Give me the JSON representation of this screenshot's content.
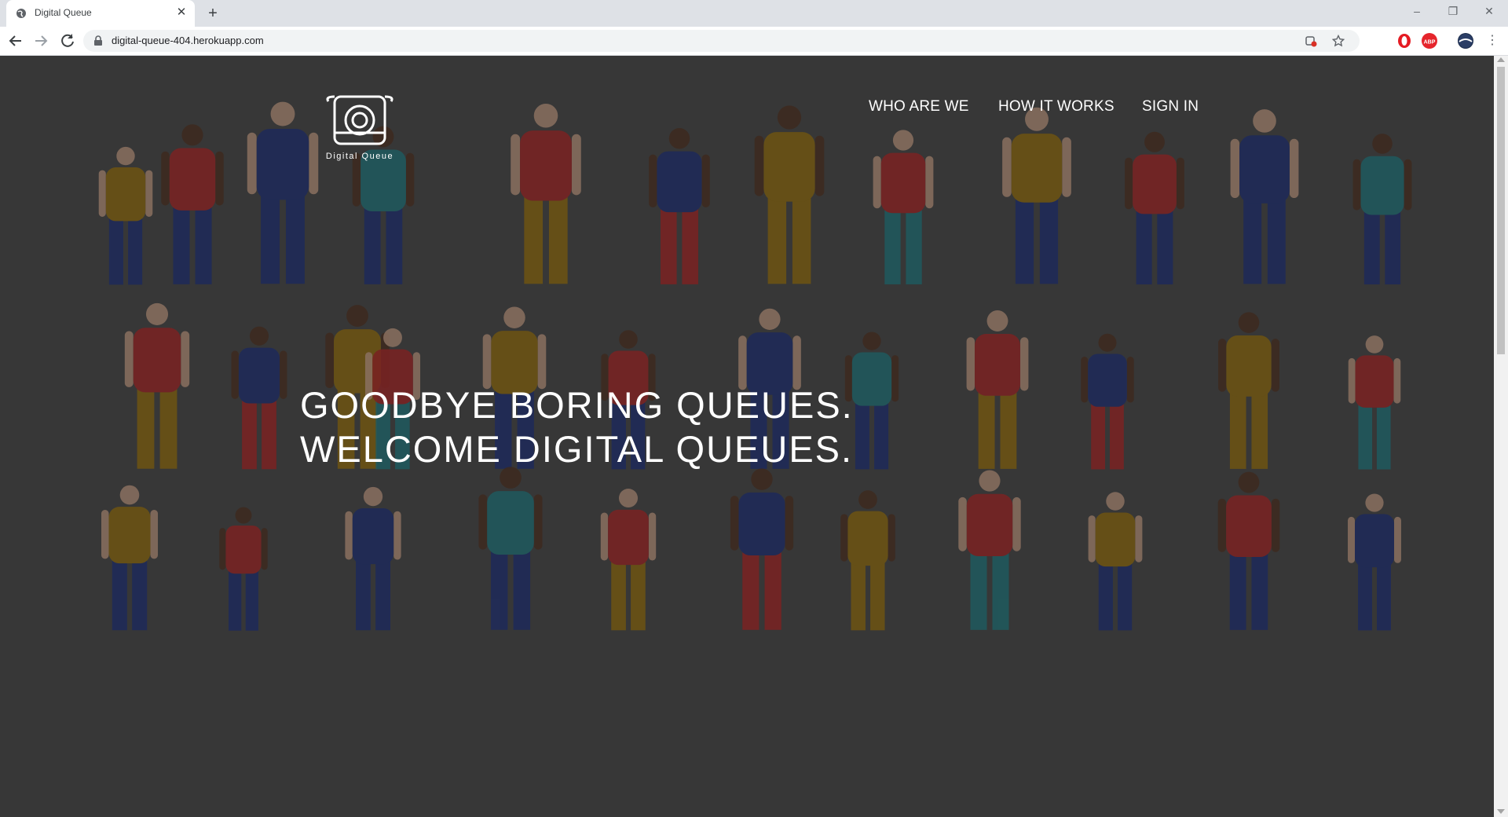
{
  "browser": {
    "tab_title": "Digital Queue",
    "url": "digital-queue-404.herokuapp.com"
  },
  "site": {
    "logo_text": "Digital Queue",
    "nav": [
      "WHO ARE WE",
      "HOW IT WORKS",
      "SIGN IN"
    ],
    "hero_line1": "GOODBYE BORING QUEUES.",
    "hero_line2": "WELCOME DIGITAL QUEUES."
  },
  "colors": {
    "page_bg": "#373737",
    "navy": "#1e2a5a",
    "red": "#7a2222",
    "mustard": "#6e5412",
    "teal": "#1f5a5e",
    "skin_dark": "#3d2a1f",
    "skin_light": "#8a7060"
  }
}
